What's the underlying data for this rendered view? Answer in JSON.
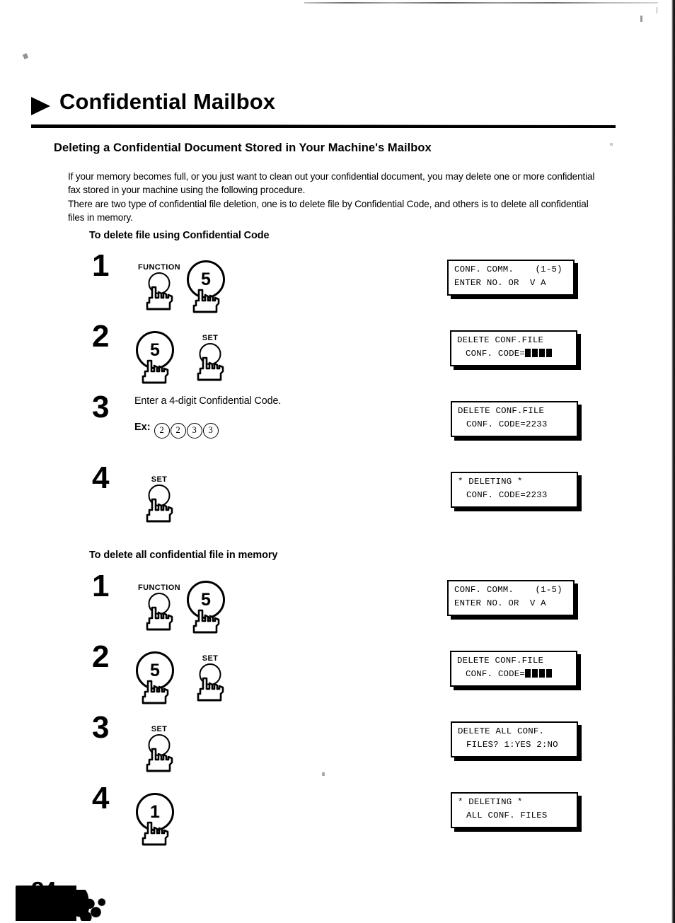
{
  "document": {
    "title": "Confidential Mailbox",
    "section_heading": "Deleting a Confidential Document Stored in Your Machine's Mailbox",
    "intro": "If your memory becomes full, or you just want to clean out your confidential document, you may delete one or more confidential fax stored in your machine using the following procedure.\nThere are two type of confidential file deletion, one is to delete file by Confidential Code, and others is to delete all confidential files in memory.",
    "page_number": "84"
  },
  "procedures": [
    {
      "heading": "To delete file using Confidential Code",
      "steps": [
        {
          "number": "1",
          "keys": [
            {
              "label": "FUNCTION",
              "type": "small",
              "digit": ""
            },
            {
              "label": "",
              "type": "large",
              "digit": "5"
            }
          ],
          "text": "",
          "example_label": "",
          "example_digits": [],
          "lcd": {
            "line1": "CONF. COMM.    (1-5)",
            "line2": "ENTER NO. OR  V A",
            "indent": false,
            "blocks": 0
          }
        },
        {
          "number": "2",
          "keys": [
            {
              "label": "",
              "type": "large",
              "digit": "5"
            },
            {
              "label": "SET",
              "type": "small",
              "digit": ""
            }
          ],
          "text": "",
          "example_label": "",
          "example_digits": [],
          "lcd": {
            "line1": "DELETE CONF.FILE",
            "line2": "CONF. CODE=",
            "indent": true,
            "blocks": 4
          }
        },
        {
          "number": "3",
          "keys": [],
          "text": "Enter a 4-digit Confidential Code.",
          "example_label": "Ex:",
          "example_digits": [
            "2",
            "2",
            "3",
            "3"
          ],
          "lcd": {
            "line1": "DELETE CONF.FILE",
            "line2": "CONF. CODE=2233",
            "indent": true,
            "blocks": 0
          }
        },
        {
          "number": "4",
          "keys": [
            {
              "label": "SET",
              "type": "small",
              "digit": ""
            }
          ],
          "text": "",
          "example_label": "",
          "example_digits": [],
          "lcd": {
            "line1": "* DELETING *",
            "line2": "CONF. CODE=2233",
            "indent": true,
            "blocks": 0
          }
        }
      ]
    },
    {
      "heading": "To delete all confidential file in memory",
      "steps": [
        {
          "number": "1",
          "keys": [
            {
              "label": "FUNCTION",
              "type": "small",
              "digit": ""
            },
            {
              "label": "",
              "type": "large",
              "digit": "5"
            }
          ],
          "text": "",
          "example_label": "",
          "example_digits": [],
          "lcd": {
            "line1": "CONF. COMM.    (1-5)",
            "line2": "ENTER NO. OR  V A",
            "indent": false,
            "blocks": 0
          }
        },
        {
          "number": "2",
          "keys": [
            {
              "label": "",
              "type": "large",
              "digit": "5"
            },
            {
              "label": "SET",
              "type": "small",
              "digit": ""
            }
          ],
          "text": "",
          "example_label": "",
          "example_digits": [],
          "lcd": {
            "line1": "DELETE CONF.FILE",
            "line2": "CONF. CODE=",
            "indent": true,
            "blocks": 4
          }
        },
        {
          "number": "3",
          "keys": [
            {
              "label": "SET",
              "type": "small",
              "digit": ""
            }
          ],
          "text": "",
          "example_label": "",
          "example_digits": [],
          "lcd": {
            "line1": "DELETE ALL CONF.",
            "line2": "FILES? 1:YES 2:NO",
            "indent": true,
            "blocks": 0
          }
        },
        {
          "number": "4",
          "keys": [
            {
              "label": "",
              "type": "large",
              "digit": "1"
            }
          ],
          "text": "",
          "example_label": "",
          "example_digits": [],
          "lcd": {
            "line1": "* DELETING *",
            "line2": "ALL CONF. FILES",
            "indent": true,
            "blocks": 0
          }
        }
      ]
    }
  ]
}
